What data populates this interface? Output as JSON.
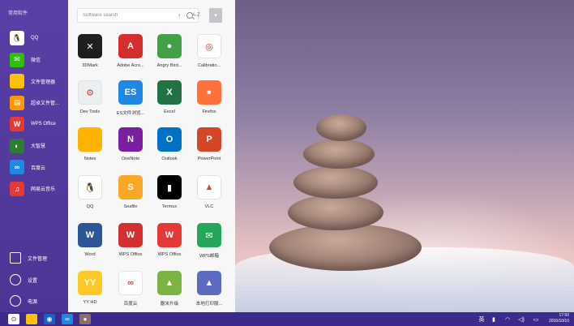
{
  "sidebar": {
    "title": "常用软件",
    "items": [
      {
        "label": "QQ",
        "icon": "qq-icon",
        "color": "#ffffff",
        "glyph": "🐧"
      },
      {
        "label": "微信",
        "icon": "wechat-icon",
        "color": "#2dc100",
        "glyph": "✉"
      },
      {
        "label": "文件管理器",
        "icon": "folder-icon",
        "color": "#ffc107",
        "glyph": ""
      },
      {
        "label": "超卓文件管...",
        "icon": "file-manager-icon",
        "color": "#ff9800",
        "glyph": "▤"
      },
      {
        "label": "WPS Office",
        "icon": "wps-icon",
        "color": "#e53935",
        "glyph": "W"
      },
      {
        "label": "大智慧",
        "icon": "finance-app-icon",
        "color": "#2e7d32",
        "glyph": "◐"
      },
      {
        "label": "百度云",
        "icon": "baidu-cloud-icon",
        "color": "#1e88e5",
        "glyph": "∞"
      },
      {
        "label": "网易云音乐",
        "icon": "netease-music-icon",
        "color": "#e53935",
        "glyph": "♫"
      }
    ],
    "bottom": [
      {
        "label": "文件管理",
        "icon": "folder-outline-icon"
      },
      {
        "label": "设置",
        "icon": "settings-icon"
      },
      {
        "label": "电源",
        "icon": "power-icon"
      }
    ]
  },
  "search": {
    "placeholder": "Software search"
  },
  "sort": {
    "up": "↑",
    "label": "A-Z",
    "button": "▾"
  },
  "apps": [
    {
      "label": "3DMark",
      "icon": "3dmark-icon",
      "color": "#1f1f1f",
      "glyph": "✕"
    },
    {
      "label": "Adobe Acro...",
      "icon": "adobe-acrobat-icon",
      "color": "#d32f2f",
      "glyph": "A"
    },
    {
      "label": "Angry Bird...",
      "icon": "angry-birds-icon",
      "color": "#43a047",
      "glyph": "●"
    },
    {
      "label": "Calibratio...",
      "icon": "calibration-icon",
      "color": "#ffffff",
      "glyph": "◎"
    },
    {
      "label": "Dev Tools",
      "icon": "dev-tools-icon",
      "color": "#eceff1",
      "glyph": "⚙"
    },
    {
      "label": "ES文件浏览...",
      "icon": "es-file-explorer-icon",
      "color": "#1e88e5",
      "glyph": "ES"
    },
    {
      "label": "Excel",
      "icon": "excel-icon",
      "color": "#217346",
      "glyph": "X"
    },
    {
      "label": "Firefox",
      "icon": "firefox-icon",
      "color": "#ff7139",
      "glyph": "●"
    },
    {
      "label": "Notes",
      "icon": "notes-icon",
      "color": "#ffb300",
      "glyph": ""
    },
    {
      "label": "OneNote",
      "icon": "onenote-icon",
      "color": "#7b1fa2",
      "glyph": "N"
    },
    {
      "label": "Outlook",
      "icon": "outlook-icon",
      "color": "#0072c6",
      "glyph": "O"
    },
    {
      "label": "PowerPoint",
      "icon": "powerpoint-icon",
      "color": "#d24726",
      "glyph": "P"
    },
    {
      "label": "QQ",
      "icon": "qq-icon",
      "color": "#ffffff",
      "glyph": "🐧"
    },
    {
      "label": "Seafile",
      "icon": "seafile-icon",
      "color": "#f9a825",
      "glyph": "S"
    },
    {
      "label": "Termux",
      "icon": "terminal-icon",
      "color": "#000000",
      "glyph": "▮"
    },
    {
      "label": "VLC",
      "icon": "vlc-icon",
      "color": "#ffffff",
      "glyph": "▲"
    },
    {
      "label": "Word",
      "icon": "word-icon",
      "color": "#2b579a",
      "glyph": "W"
    },
    {
      "label": "WPS Office",
      "icon": "wps-office-icon",
      "color": "#d32f2f",
      "glyph": "W"
    },
    {
      "label": "WPS Office",
      "icon": "wps-office-icon",
      "color": "#e53935",
      "glyph": "W"
    },
    {
      "label": "WPS邮箱",
      "icon": "wps-mail-icon",
      "color": "#26a65b",
      "glyph": "✉"
    },
    {
      "label": "YY HD",
      "icon": "yy-hd-icon",
      "color": "#ffca28",
      "glyph": "YY"
    },
    {
      "label": "百度云",
      "icon": "baidu-cloud-icon",
      "color": "#ffffff",
      "glyph": "∞"
    },
    {
      "label": "腹米升级",
      "icon": "android-upgrade-icon",
      "color": "#7cb342",
      "glyph": "▲"
    },
    {
      "label": "本地打印服...",
      "icon": "android-print-icon",
      "color": "#5c6bc0",
      "glyph": "▲"
    }
  ],
  "taskbar": {
    "items": [
      {
        "icon": "start-menu-icon",
        "color": "#ffffff",
        "glyph": "⊙"
      },
      {
        "icon": "folder-icon",
        "color": "#ffc107",
        "glyph": ""
      },
      {
        "icon": "browser-icon",
        "color": "#1565c0",
        "glyph": "◉"
      },
      {
        "icon": "baidu-cloud-icon",
        "color": "#1e88e5",
        "glyph": "∞"
      },
      {
        "icon": "game-icon",
        "color": "#8d6e63",
        "glyph": "●"
      }
    ],
    "tray": [
      {
        "label": "英",
        "icon": "input-method-icon"
      },
      {
        "label": "▮",
        "icon": "usb-icon"
      },
      {
        "label": "◠",
        "icon": "wifi-icon"
      },
      {
        "label": "◁)",
        "icon": "volume-icon"
      },
      {
        "label": "▭",
        "icon": "notification-icon"
      }
    ],
    "time": "17:50",
    "date": "2016/10/10"
  }
}
